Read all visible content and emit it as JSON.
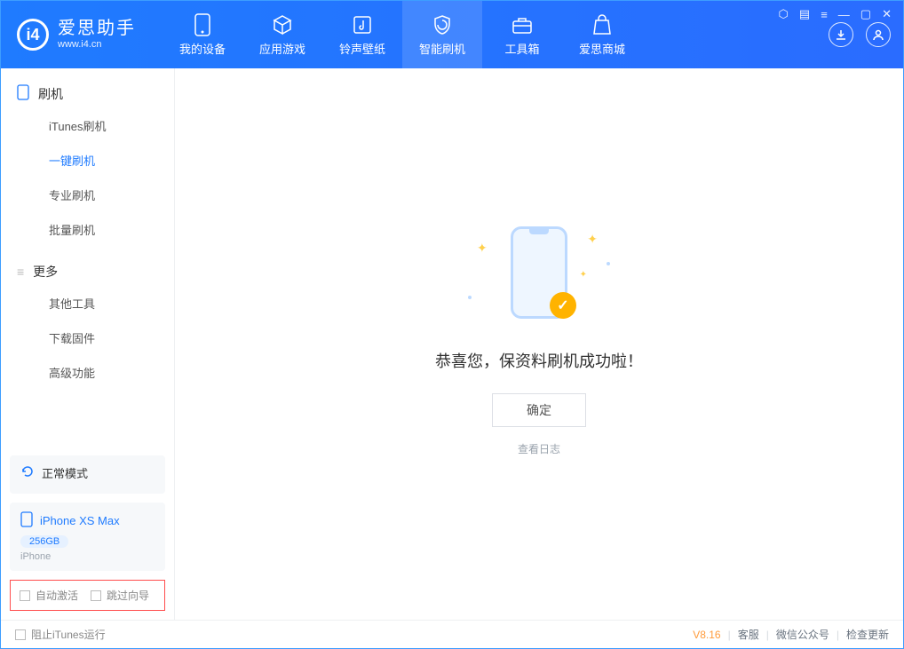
{
  "app": {
    "name_cn": "爱思助手",
    "name_en": "www.i4.cn"
  },
  "nav": [
    {
      "key": "device",
      "label": "我的设备"
    },
    {
      "key": "apps",
      "label": "应用游戏"
    },
    {
      "key": "ring",
      "label": "铃声壁纸"
    },
    {
      "key": "flash",
      "label": "智能刷机"
    },
    {
      "key": "tools",
      "label": "工具箱"
    },
    {
      "key": "store",
      "label": "爱思商城"
    }
  ],
  "sidebar": {
    "section1": {
      "title": "刷机",
      "items": [
        {
          "label": "iTunes刷机"
        },
        {
          "label": "一键刷机",
          "active": true
        },
        {
          "label": "专业刷机"
        },
        {
          "label": "批量刷机"
        }
      ]
    },
    "section2": {
      "title": "更多",
      "items": [
        {
          "label": "其他工具"
        },
        {
          "label": "下载固件"
        },
        {
          "label": "高级功能"
        }
      ]
    }
  },
  "mode_card": {
    "label": "正常模式"
  },
  "device_card": {
    "name": "iPhone XS Max",
    "capacity": "256GB",
    "type": "iPhone"
  },
  "options": {
    "auto_activate": "自动激活",
    "skip_guide": "跳过向导"
  },
  "main": {
    "message": "恭喜您，保资料刷机成功啦！",
    "ok": "确定",
    "view_log": "查看日志"
  },
  "footer": {
    "block_itunes": "阻止iTunes运行",
    "version": "V8.16",
    "links": [
      "客服",
      "微信公众号",
      "检查更新"
    ]
  }
}
